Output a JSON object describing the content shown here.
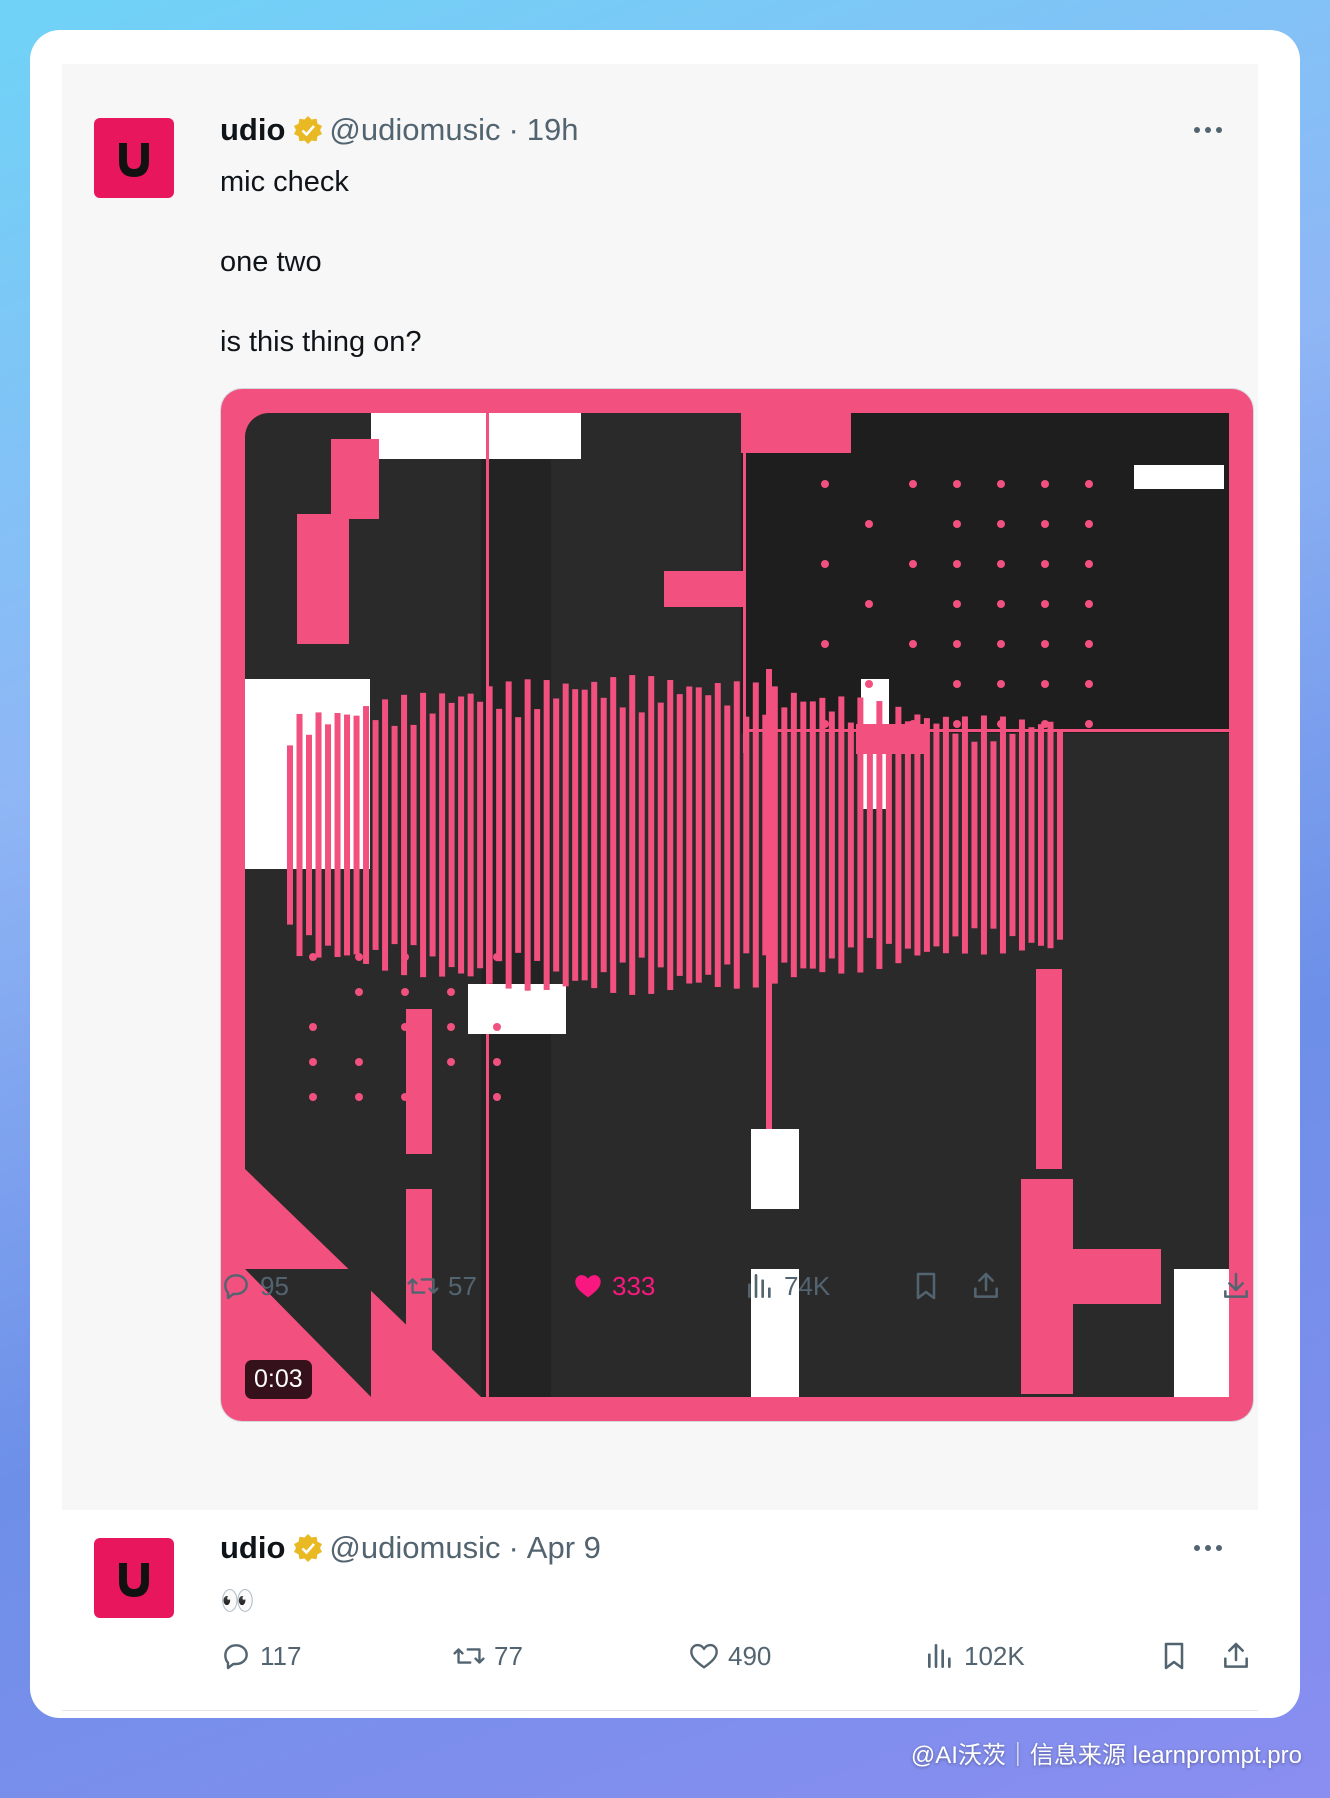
{
  "tweets": [
    {
      "name": "udio",
      "handle": "@udiomusic",
      "separator": "·",
      "time": "19h",
      "text_lines": [
        "mic check",
        "one two",
        "is this thing on?"
      ],
      "media": {
        "type": "video",
        "duration": "0:03",
        "colors": {
          "pink": "#f2507f",
          "dark": "#2a2a2a",
          "white": "#ffffff"
        }
      },
      "actions": {
        "replies": "95",
        "reposts": "57",
        "likes": "333",
        "views": "74K"
      },
      "liked": true
    },
    {
      "name": "udio",
      "handle": "@udiomusic",
      "separator": "·",
      "time": "Apr 9",
      "text": "👀",
      "actions": {
        "replies": "117",
        "reposts": "77",
        "likes": "490",
        "views": "102K"
      },
      "liked": false
    }
  ],
  "colors": {
    "brand_avatar": "#e8175d",
    "verified_badge": "#e8b923",
    "like_active": "#f91880",
    "muted_text": "#536471"
  },
  "watermark": "@AI沃茨｜信息来源 learnprompt.pro"
}
